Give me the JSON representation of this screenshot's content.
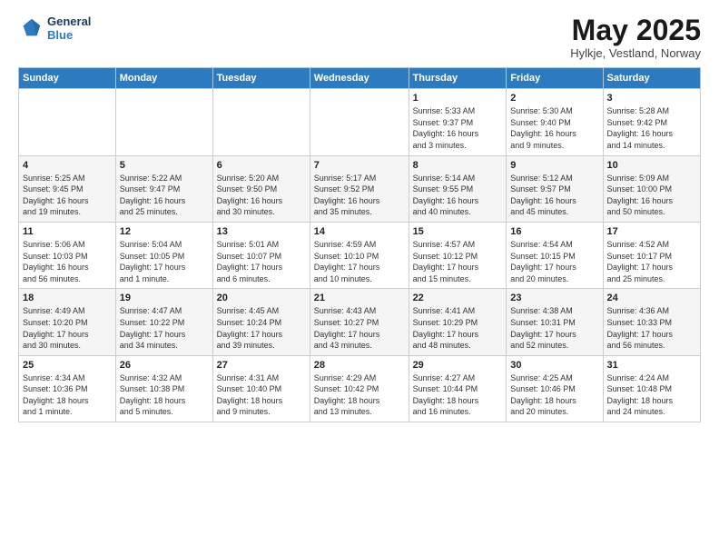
{
  "header": {
    "logo_line1": "General",
    "logo_line2": "Blue",
    "title": "May 2025",
    "subtitle": "Hylkje, Vestland, Norway"
  },
  "days_of_week": [
    "Sunday",
    "Monday",
    "Tuesday",
    "Wednesday",
    "Thursday",
    "Friday",
    "Saturday"
  ],
  "weeks": [
    {
      "cells": [
        {
          "date": "",
          "info": ""
        },
        {
          "date": "",
          "info": ""
        },
        {
          "date": "",
          "info": ""
        },
        {
          "date": "",
          "info": ""
        },
        {
          "date": "1",
          "info": "Sunrise: 5:33 AM\nSunset: 9:37 PM\nDaylight: 16 hours\nand 3 minutes."
        },
        {
          "date": "2",
          "info": "Sunrise: 5:30 AM\nSunset: 9:40 PM\nDaylight: 16 hours\nand 9 minutes."
        },
        {
          "date": "3",
          "info": "Sunrise: 5:28 AM\nSunset: 9:42 PM\nDaylight: 16 hours\nand 14 minutes."
        }
      ]
    },
    {
      "cells": [
        {
          "date": "4",
          "info": "Sunrise: 5:25 AM\nSunset: 9:45 PM\nDaylight: 16 hours\nand 19 minutes."
        },
        {
          "date": "5",
          "info": "Sunrise: 5:22 AM\nSunset: 9:47 PM\nDaylight: 16 hours\nand 25 minutes."
        },
        {
          "date": "6",
          "info": "Sunrise: 5:20 AM\nSunset: 9:50 PM\nDaylight: 16 hours\nand 30 minutes."
        },
        {
          "date": "7",
          "info": "Sunrise: 5:17 AM\nSunset: 9:52 PM\nDaylight: 16 hours\nand 35 minutes."
        },
        {
          "date": "8",
          "info": "Sunrise: 5:14 AM\nSunset: 9:55 PM\nDaylight: 16 hours\nand 40 minutes."
        },
        {
          "date": "9",
          "info": "Sunrise: 5:12 AM\nSunset: 9:57 PM\nDaylight: 16 hours\nand 45 minutes."
        },
        {
          "date": "10",
          "info": "Sunrise: 5:09 AM\nSunset: 10:00 PM\nDaylight: 16 hours\nand 50 minutes."
        }
      ]
    },
    {
      "cells": [
        {
          "date": "11",
          "info": "Sunrise: 5:06 AM\nSunset: 10:03 PM\nDaylight: 16 hours\nand 56 minutes."
        },
        {
          "date": "12",
          "info": "Sunrise: 5:04 AM\nSunset: 10:05 PM\nDaylight: 17 hours\nand 1 minute."
        },
        {
          "date": "13",
          "info": "Sunrise: 5:01 AM\nSunset: 10:07 PM\nDaylight: 17 hours\nand 6 minutes."
        },
        {
          "date": "14",
          "info": "Sunrise: 4:59 AM\nSunset: 10:10 PM\nDaylight: 17 hours\nand 10 minutes."
        },
        {
          "date": "15",
          "info": "Sunrise: 4:57 AM\nSunset: 10:12 PM\nDaylight: 17 hours\nand 15 minutes."
        },
        {
          "date": "16",
          "info": "Sunrise: 4:54 AM\nSunset: 10:15 PM\nDaylight: 17 hours\nand 20 minutes."
        },
        {
          "date": "17",
          "info": "Sunrise: 4:52 AM\nSunset: 10:17 PM\nDaylight: 17 hours\nand 25 minutes."
        }
      ]
    },
    {
      "cells": [
        {
          "date": "18",
          "info": "Sunrise: 4:49 AM\nSunset: 10:20 PM\nDaylight: 17 hours\nand 30 minutes."
        },
        {
          "date": "19",
          "info": "Sunrise: 4:47 AM\nSunset: 10:22 PM\nDaylight: 17 hours\nand 34 minutes."
        },
        {
          "date": "20",
          "info": "Sunrise: 4:45 AM\nSunset: 10:24 PM\nDaylight: 17 hours\nand 39 minutes."
        },
        {
          "date": "21",
          "info": "Sunrise: 4:43 AM\nSunset: 10:27 PM\nDaylight: 17 hours\nand 43 minutes."
        },
        {
          "date": "22",
          "info": "Sunrise: 4:41 AM\nSunset: 10:29 PM\nDaylight: 17 hours\nand 48 minutes."
        },
        {
          "date": "23",
          "info": "Sunrise: 4:38 AM\nSunset: 10:31 PM\nDaylight: 17 hours\nand 52 minutes."
        },
        {
          "date": "24",
          "info": "Sunrise: 4:36 AM\nSunset: 10:33 PM\nDaylight: 17 hours\nand 56 minutes."
        }
      ]
    },
    {
      "cells": [
        {
          "date": "25",
          "info": "Sunrise: 4:34 AM\nSunset: 10:36 PM\nDaylight: 18 hours\nand 1 minute."
        },
        {
          "date": "26",
          "info": "Sunrise: 4:32 AM\nSunset: 10:38 PM\nDaylight: 18 hours\nand 5 minutes."
        },
        {
          "date": "27",
          "info": "Sunrise: 4:31 AM\nSunset: 10:40 PM\nDaylight: 18 hours\nand 9 minutes."
        },
        {
          "date": "28",
          "info": "Sunrise: 4:29 AM\nSunset: 10:42 PM\nDaylight: 18 hours\nand 13 minutes."
        },
        {
          "date": "29",
          "info": "Sunrise: 4:27 AM\nSunset: 10:44 PM\nDaylight: 18 hours\nand 16 minutes."
        },
        {
          "date": "30",
          "info": "Sunrise: 4:25 AM\nSunset: 10:46 PM\nDaylight: 18 hours\nand 20 minutes."
        },
        {
          "date": "31",
          "info": "Sunrise: 4:24 AM\nSunset: 10:48 PM\nDaylight: 18 hours\nand 24 minutes."
        }
      ]
    }
  ]
}
